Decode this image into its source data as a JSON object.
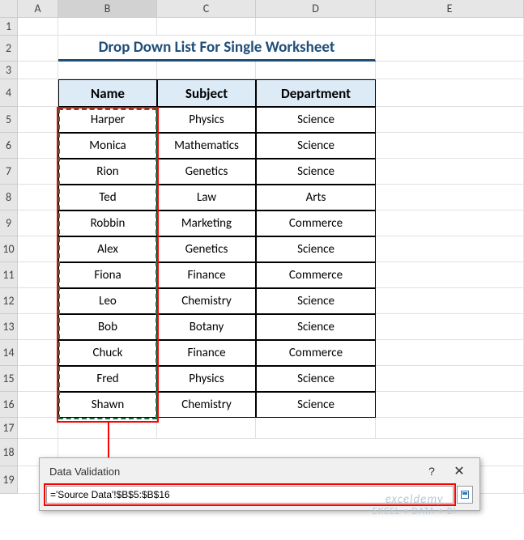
{
  "columns": [
    "A",
    "B",
    "C",
    "D",
    "E"
  ],
  "rows": [
    "1",
    "2",
    "3",
    "4",
    "5",
    "6",
    "7",
    "8",
    "9",
    "10",
    "11",
    "12",
    "13",
    "14",
    "15",
    "16",
    "17",
    "18",
    "19"
  ],
  "title": "Drop Down List For Single Worksheet",
  "headers": {
    "b": "Name",
    "c": "Subject",
    "d": "Department"
  },
  "data": [
    {
      "name": "Harper",
      "subject": "Physics",
      "dept": "Science"
    },
    {
      "name": "Monica",
      "subject": "Mathematics",
      "dept": "Science"
    },
    {
      "name": "Rion",
      "subject": "Genetics",
      "dept": "Science"
    },
    {
      "name": "Ted",
      "subject": "Law",
      "dept": "Arts"
    },
    {
      "name": "Robbin",
      "subject": "Marketing",
      "dept": "Commerce"
    },
    {
      "name": "Alex",
      "subject": "Genetics",
      "dept": "Science"
    },
    {
      "name": "Fiona",
      "subject": "Finance",
      "dept": "Commerce"
    },
    {
      "name": "Leo",
      "subject": "Chemistry",
      "dept": "Science"
    },
    {
      "name": "Bob",
      "subject": "Botany",
      "dept": "Science"
    },
    {
      "name": "Chuck",
      "subject": "Finance",
      "dept": "Commerce"
    },
    {
      "name": "Fred",
      "subject": "Physics",
      "dept": "Science"
    },
    {
      "name": "Shawn",
      "subject": "Chemistry",
      "dept": "Science"
    }
  ],
  "dialog": {
    "title": "Data Validation",
    "help": "?",
    "close": "✕",
    "formula": "='Source Data'!$B$5:$B$16"
  },
  "watermark": {
    "line1": "exceldemy",
    "line2": "— EXCEL • DATA • BI —"
  }
}
